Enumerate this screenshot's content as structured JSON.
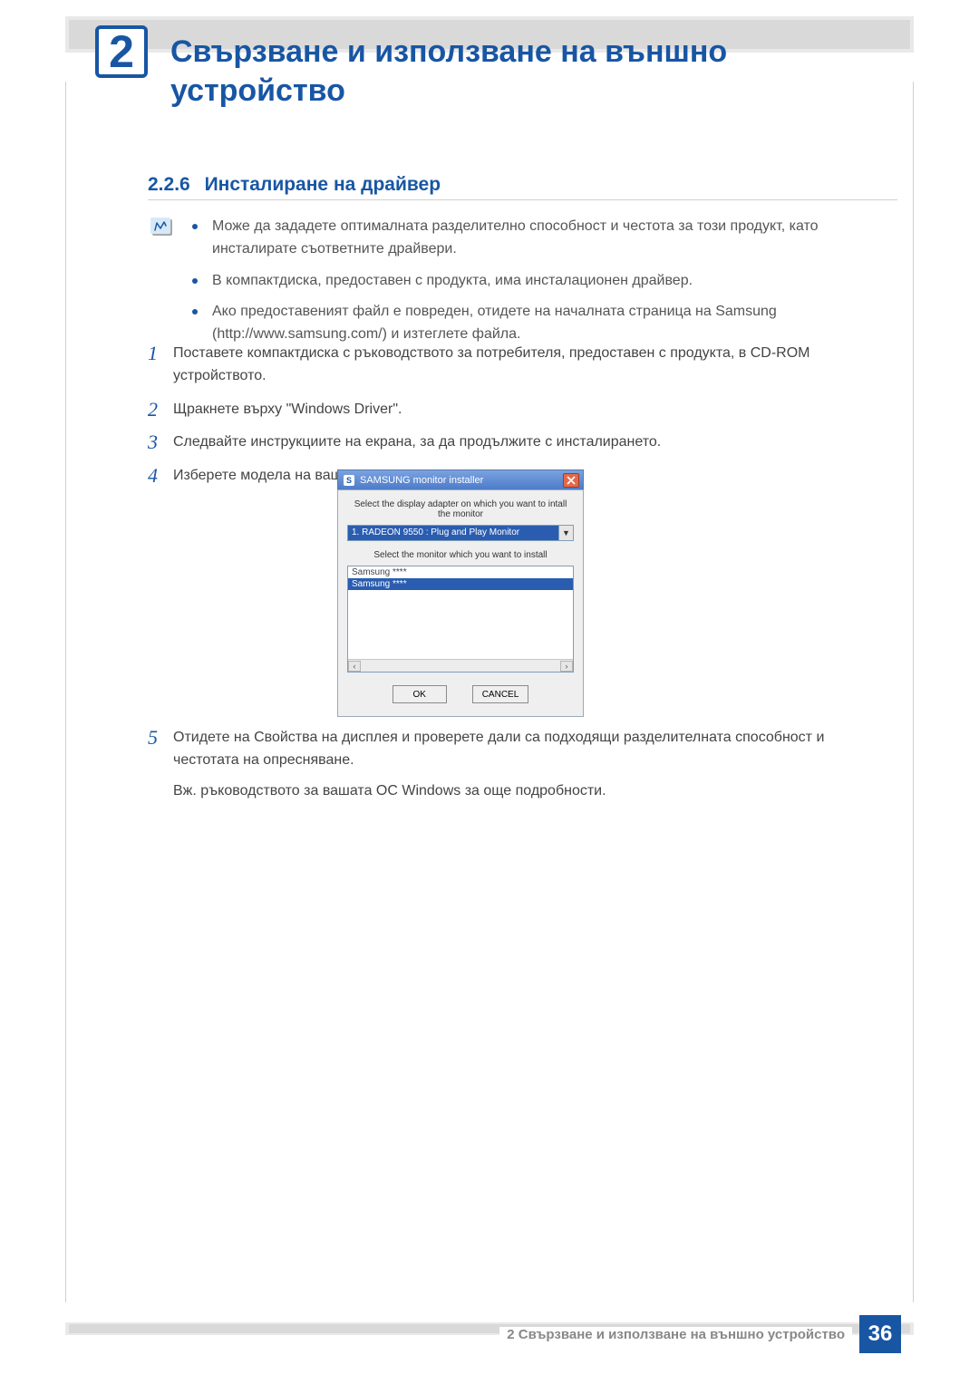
{
  "chapter": {
    "number": "2",
    "title": "Свързване и използване на външно устройство"
  },
  "section": {
    "number": "2.2.6",
    "title": "Инсталиране на драйвер"
  },
  "notes": [
    "Може да зададете оптималната разделително способност и честота за този продукт, като инсталирате съответните драйвери.",
    "В компактдиска, предоставен с продукта, има инсталационен драйвер.",
    "Ако предоставеният файл е повреден, отидете на началната страница на Samsung (http://www.samsung.com/) и изтеглете файла."
  ],
  "steps": {
    "s1": "Поставете компактдиска с ръководството за потребителя, предоставен с продукта, в CD-ROM устройството.",
    "s2": "Щракнете върху \"Windows Driver\".",
    "s3": "Следвайте инструкциите на екрана, за да продължите с инсталирането.",
    "s4": "Изберете модела на вашия продукт от списъка с модели.",
    "s5": "Отидете на Свойства на дисплея и проверете дали са подходящи разделителната способност и честотата на опресняване.",
    "s5_extra": "Вж. ръководството за вашата ОС Windows за още подробности."
  },
  "installer": {
    "title": "SAMSUNG monitor installer",
    "label_adapter": "Select the display adapter on which you want to intall the monitor",
    "adapter_value": "1. RADEON 9550 : Plug and Play Monitor",
    "label_monitor": "Select the monitor which you want to install",
    "list_items": [
      "Samsung ****",
      "Samsung ****"
    ],
    "ok": "OK",
    "cancel": "CANCEL"
  },
  "footer": {
    "text": "2 Свързване и използване на външно устройство",
    "page": "36"
  },
  "chart_data": null
}
